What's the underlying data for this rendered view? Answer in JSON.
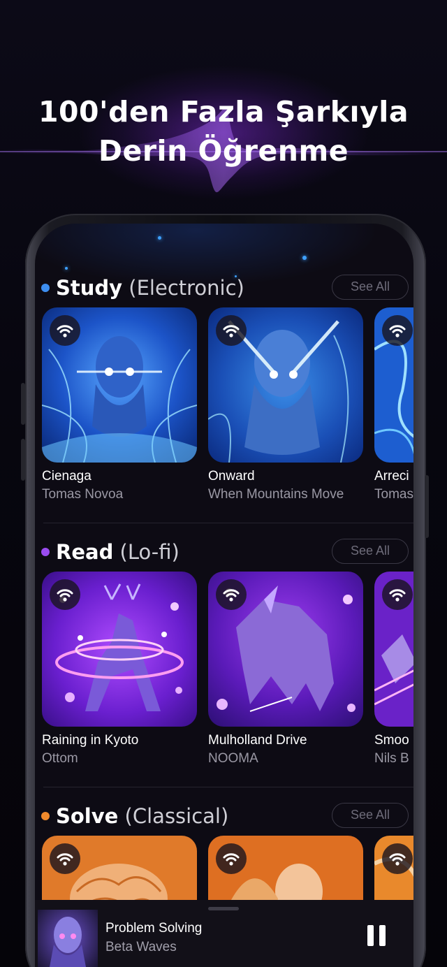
{
  "headline": {
    "line1": "100'den Fazla Şarkıyla",
    "line2": "Derin Öğrenme"
  },
  "colors": {
    "study_dot": "#3d8ef0",
    "read_dot": "#9a4cf0",
    "solve_dot": "#f08a2c",
    "accent": "#7a3fe0"
  },
  "sections": [
    {
      "title": "Study",
      "subtitle": "(Electronic)",
      "see_all": "See All",
      "cards": [
        {
          "title": "Cienaga",
          "artist": "Tomas Novoa"
        },
        {
          "title": "Onward",
          "artist": "When Mountains Move"
        },
        {
          "title": "Arreci",
          "artist": "Tomas"
        }
      ]
    },
    {
      "title": "Read",
      "subtitle": "(Lo-fi)",
      "see_all": "See All",
      "cards": [
        {
          "title": "Raining in Kyoto",
          "artist": "Ottom"
        },
        {
          "title": "Mulholland Drive",
          "artist": "NOOMA"
        },
        {
          "title": "Smoo",
          "artist": "Nils B"
        }
      ]
    },
    {
      "title": "Solve",
      "subtitle": "(Classical)",
      "see_all": "See All",
      "cards": [
        {
          "title": "",
          "artist": ""
        },
        {
          "title": "",
          "artist": ""
        },
        {
          "title": "",
          "artist": ""
        }
      ]
    }
  ],
  "player": {
    "title": "Problem Solving",
    "artist": "Beta Waves",
    "control_icon": "pause-icon"
  }
}
